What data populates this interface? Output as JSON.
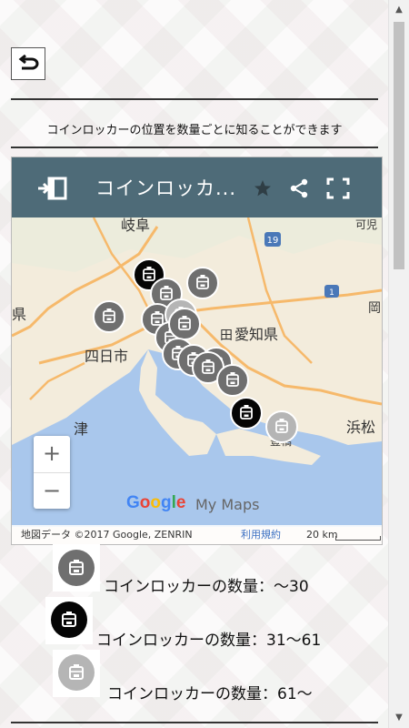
{
  "description": "コインロッカーの位置を数量ごとに知ることができます",
  "map": {
    "title": "コインロッカ...",
    "place_labels": [
      "岐阜",
      "愛知県",
      "四日市",
      "津",
      "浜松",
      "県",
      "可児",
      "岡",
      "田",
      "豊橋"
    ],
    "zoom_in": "+",
    "zoom_out": "−",
    "logo": "Google",
    "logo_suffix": "My Maps",
    "attribution": "地図データ ©2017 Google, ZENRIN",
    "terms": "利用規約",
    "scale": "20 km",
    "markers": [
      {
        "level": "dark"
      },
      {
        "level": "medium"
      },
      {
        "level": "medium"
      },
      {
        "level": "medium"
      },
      {
        "level": "medium"
      },
      {
        "level": "light"
      },
      {
        "level": "medium"
      },
      {
        "level": "medium"
      },
      {
        "level": "medium"
      },
      {
        "level": "medium"
      },
      {
        "level": "medium"
      },
      {
        "level": "medium"
      },
      {
        "level": "medium"
      },
      {
        "level": "dark"
      },
      {
        "level": "light"
      }
    ]
  },
  "legend": [
    {
      "label": "コインロッカーの数量：～30",
      "color": "#6f6f6f"
    },
    {
      "label": "コインロッカーの数量：31～61",
      "color": "#050505"
    },
    {
      "label": "コインロッカーの数量：61～",
      "color": "#b5b5b5"
    }
  ],
  "colors": {
    "header": "#4e6b78",
    "water": "#a9c7ec",
    "land": "#f3ecdc",
    "highway": "#f6b96b"
  }
}
